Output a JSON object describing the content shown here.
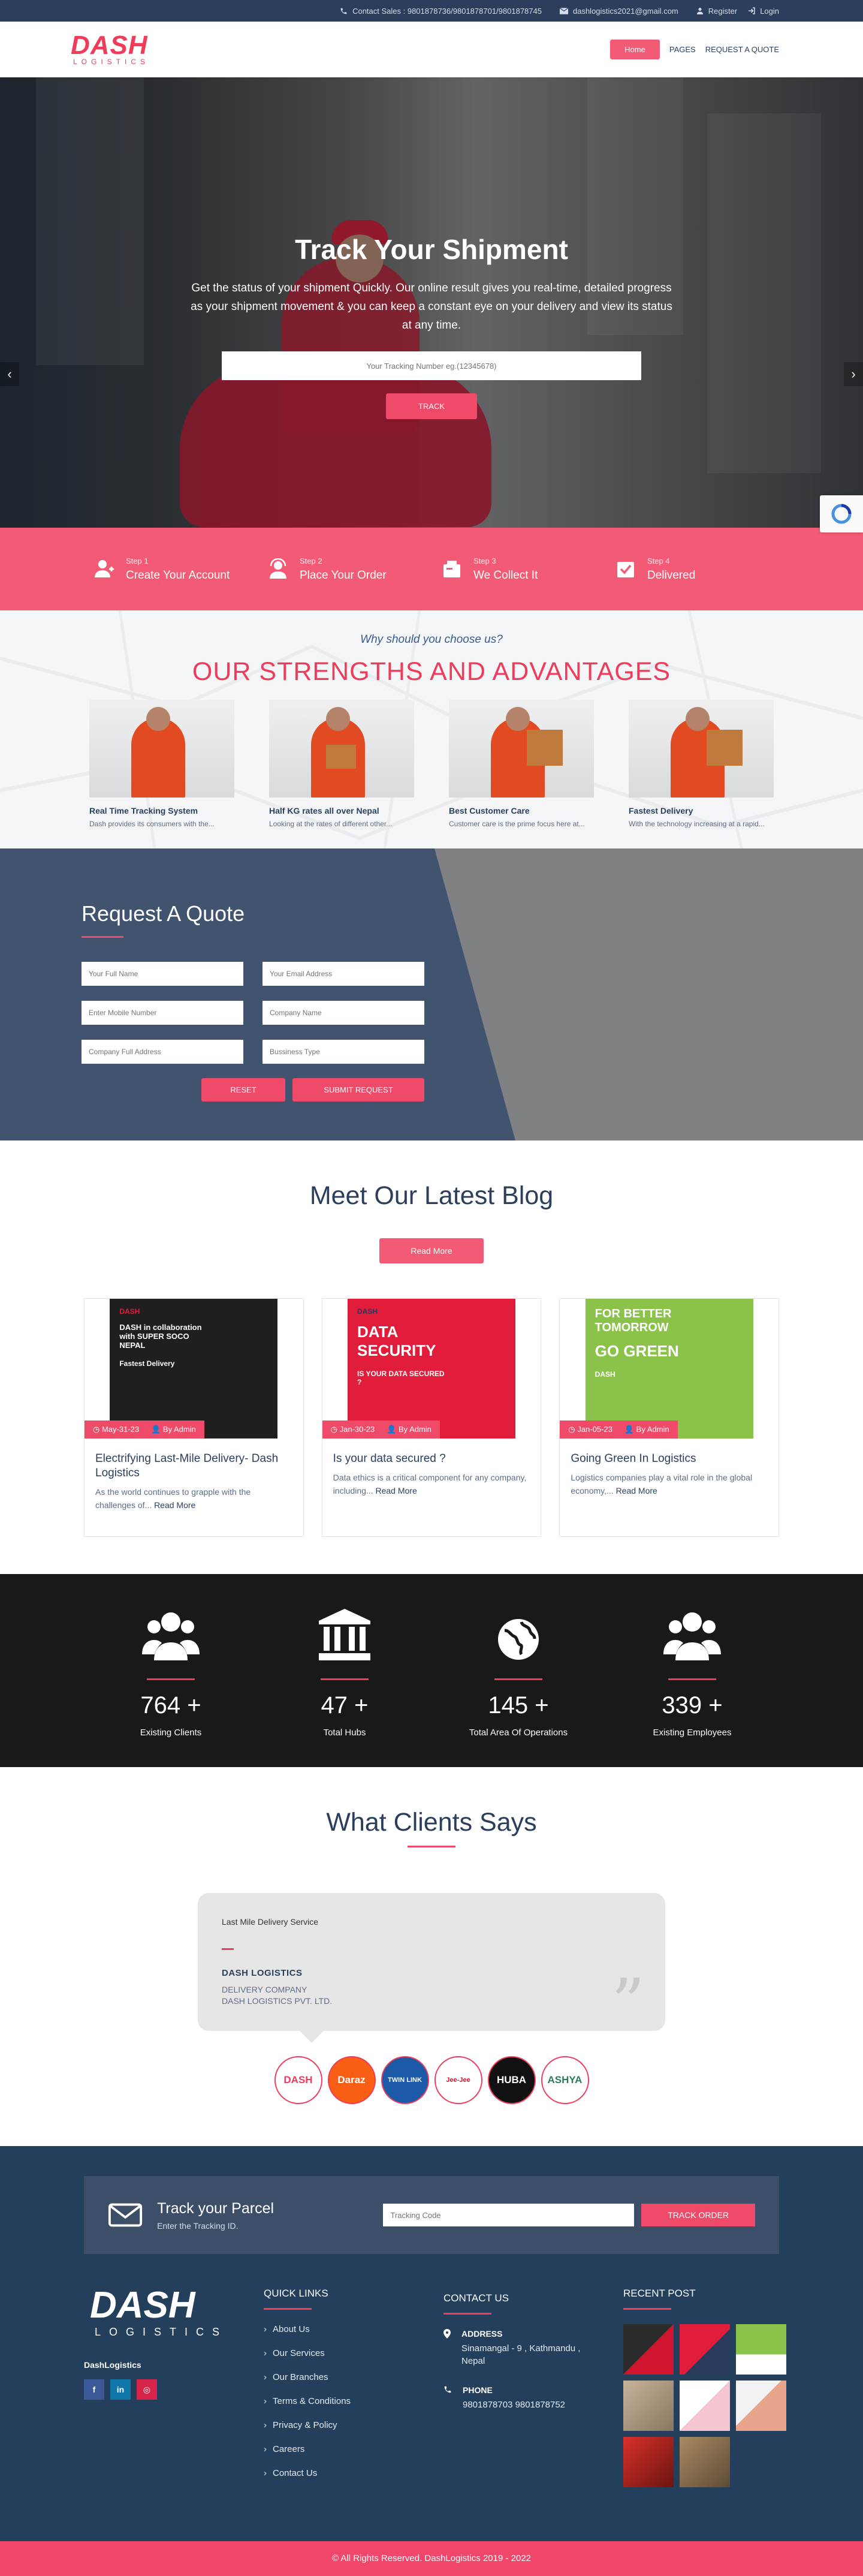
{
  "topbar": {
    "sales": "Contact Sales : 9801878736/9801878701/9801878745",
    "email": "dashlogistics2021@gmail.com",
    "register": "Register",
    "login": "Login"
  },
  "header": {
    "logo_main": "DASH",
    "logo_sub": "LOGISTICS",
    "nav": [
      "Home",
      "PAGES",
      "REQUEST A QUOTE"
    ]
  },
  "hero": {
    "title": "Track Your Shipment",
    "text": "Get the status of your shipment Quickly. Our online result gives you real-time, detailed progress as your shipment movement & you can keep a constant eye on your delivery and view its status at any time.",
    "placeholder": "Your Tracking Number eg.(12345678)",
    "button": "TRACK"
  },
  "steps": [
    {
      "num": "Step 1",
      "title": "Create Your Account",
      "icon": "user-add-icon"
    },
    {
      "num": "Step 2",
      "title": "Place Your Order",
      "icon": "user-headset-icon"
    },
    {
      "num": "Step 3",
      "title": "We Collect It",
      "icon": "package-icon"
    },
    {
      "num": "Step 4",
      "title": "Delivered",
      "icon": "delivered-icon"
    }
  ],
  "strengths": {
    "why": "Why should you choose us?",
    "title": "OUR STRENGTHS AND ADVANTAGES",
    "cards": [
      {
        "title": "Real Time Tracking System",
        "desc": "Dash provides its consumers with the..."
      },
      {
        "title": "Half KG rates all over Nepal",
        "desc": "Looking at the rates of different other..."
      },
      {
        "title": "Best Customer Care",
        "desc": "Customer care is the prime focus here at..."
      },
      {
        "title": "Fastest Delivery",
        "desc": "With the technology increasing at a rapid..."
      }
    ]
  },
  "quote": {
    "title": "Request A Quote",
    "fields": [
      "Your Full Name",
      "Your Email Address",
      "Enter Mobile Number",
      "Company Name",
      "Company Full Address",
      "Bussiness Type"
    ],
    "reset": "RESET",
    "submit": "SUBMIT REQUEST"
  },
  "blog": {
    "title": "Meet Our Latest Blog",
    "read_more": "Read More",
    "posts": [
      {
        "date": "May-31-23",
        "author": "By Admin",
        "title": "Electrifying Last-Mile Delivery- Dash Logistics",
        "desc": "As the world continues to grapple with the challenges of...",
        "more": "Read More",
        "img_lines": [
          "DASH",
          "DASH in collaboration with SUPER SOCO NEPAL",
          "Fastest Delivery"
        ]
      },
      {
        "date": "Jan-30-23",
        "author": "By Admin",
        "title": "Is your data secured ?",
        "desc": "Data ethics is a critical component for any company, including...",
        "more": "Read More",
        "img_lines": [
          "DASH",
          "DATA SECURITY",
          "IS YOUR DATA SECURED ?"
        ]
      },
      {
        "date": "Jan-05-23",
        "author": "By Admin",
        "title": "Going Green In Logistics",
        "desc": "Logistics companies play a vital role in the global economy,...",
        "more": "Read More",
        "img_lines": [
          "FOR BETTER TOMORROW",
          "GO GREEN",
          "DASH"
        ]
      }
    ]
  },
  "stats": [
    {
      "num": "764 +",
      "label": "Existing Clients",
      "icon": "users-icon"
    },
    {
      "num": "47 +",
      "label": "Total Hubs",
      "icon": "institution-icon"
    },
    {
      "num": "145 +",
      "label": "Total Area Of Operations",
      "icon": "globe-icon"
    },
    {
      "num": "339 +",
      "label": "Existing Employees",
      "icon": "users-icon"
    }
  ],
  "testimonials": {
    "title": "What Clients Says",
    "service": "Last Mile Delivery Service",
    "name": "DASH LOGISTICS",
    "role1": "DELIVERY COMPANY",
    "role2": "DASH LOGISTICS PVT. LTD.",
    "clients": [
      {
        "name": "DASH",
        "bg": "#ffffff",
        "fg": "#ef3c5a"
      },
      {
        "name": "Daraz",
        "bg": "#f85e14",
        "fg": "#ffffff"
      },
      {
        "name": "TWIN LINK",
        "bg": "#1c5aa8",
        "fg": "#ffffff"
      },
      {
        "name": "Jee-Jee",
        "bg": "#ffffff",
        "fg": "#d3162f"
      },
      {
        "name": "HUBA",
        "bg": "#111111",
        "fg": "#ffffff"
      },
      {
        "name": "ASHYA",
        "bg": "#ffffff",
        "fg": "#2e7d5a"
      }
    ]
  },
  "footer": {
    "track_title": "Track your Parcel",
    "track_sub": "Enter the Tracking ID.",
    "track_placeholder": "Tracking Code",
    "track_button": "TRACK ORDER",
    "logo_main": "DASH",
    "logo_sub": "LOGISTICS",
    "company": "DashLogistics",
    "quick_title": "QUICK LINKS",
    "links": [
      "About Us",
      "Our Services",
      "Our Branches",
      "Terms & Conditions",
      "Privacy & Policy",
      "Careers",
      "Contact Us"
    ],
    "contact_title": "CONTACT US",
    "address_label": "ADDRESS",
    "address": "Sinamangal - 9 , Kathmandu , Nepal",
    "phone_label": "PHONE",
    "phone": "9801878703 9801878752",
    "recent_title": "RECENT POST",
    "copyright": "© All Rights Reserved. DashLogistics 2019 - 2022"
  },
  "colors": {
    "brand_red": "#ef3c5a",
    "navy": "#2b3f5c",
    "footer_bg": "#233f5c"
  }
}
